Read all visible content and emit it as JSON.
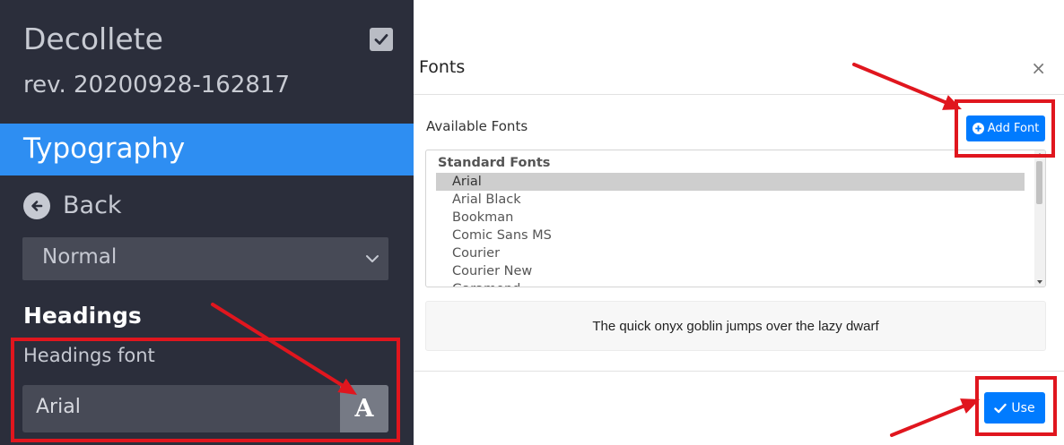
{
  "sidebar": {
    "site_name": "Decollete",
    "revision": "rev. 20200928-162817",
    "section": "Typography",
    "back_label": "Back",
    "style_select_value": "Normal",
    "headings_title": "Headings",
    "headings_font_label": "Headings font",
    "headings_font_value": "Arial",
    "font_button_glyph": "A"
  },
  "modal": {
    "title": "Fonts",
    "close_glyph": "×",
    "available_label": "Available Fonts",
    "add_font_label": "Add Font",
    "group_label": "Standard Fonts",
    "fonts": [
      "Arial",
      "Arial Black",
      "Bookman",
      "Comic Sans MS",
      "Courier",
      "Courier New",
      "Garamond"
    ],
    "selected_font": "Arial",
    "preview_text": "The quick onyx goblin jumps over the lazy dwarf",
    "use_label": "Use"
  },
  "colors": {
    "sidebar_bg": "#2b2e3b",
    "section_highlight": "#2e8ef2",
    "primary_button": "#007bff",
    "annotation_red": "#e0161e"
  }
}
